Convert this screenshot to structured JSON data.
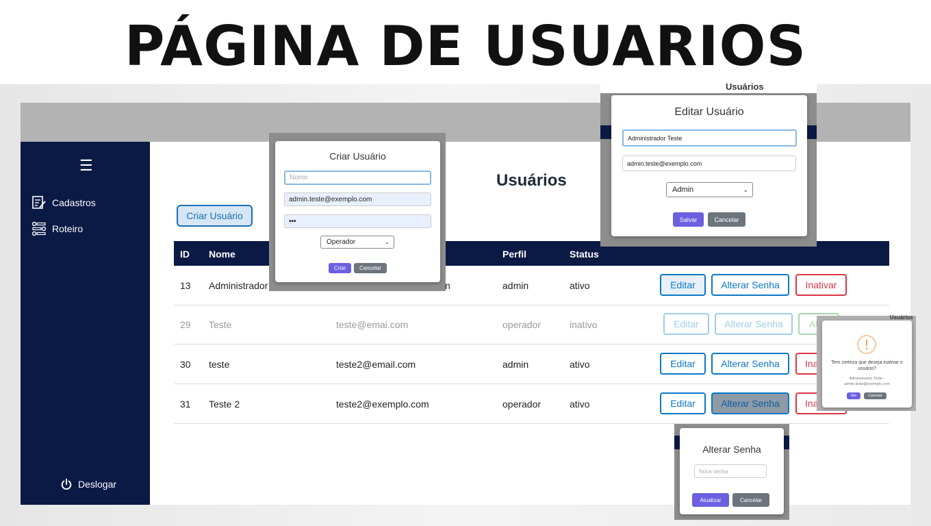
{
  "banner": {
    "title": "PÁGINA DE USUARIOS"
  },
  "sidebar": {
    "menu_icon": "hamburger-icon",
    "items": [
      {
        "label": "Cadastros",
        "icon": "form-edit-icon"
      },
      {
        "label": "Roteiro",
        "icon": "route-icon"
      }
    ],
    "logout": {
      "label": "Deslogar",
      "icon": "power-icon"
    }
  },
  "main": {
    "heading": "Usuários",
    "create_button": "Criar Usuário",
    "table": {
      "headers": [
        "ID",
        "Nome",
        "Perfil",
        "Status"
      ],
      "rows": [
        {
          "id": "13",
          "nome": "Administrador",
          "email": "n",
          "perfil": "admin",
          "status": "ativo",
          "actions": [
            "Editar",
            "Alterar Senha",
            "Inativar"
          ]
        },
        {
          "id": "29",
          "nome": "Teste",
          "email": "teste@emai.com",
          "perfil": "operador",
          "status": "inativo",
          "actions": [
            "Editar",
            "Alterar Senha",
            "At"
          ]
        },
        {
          "id": "30",
          "nome": "teste",
          "email": "teste2@email.com",
          "perfil": "admin",
          "status": "ativo",
          "actions": [
            "Editar",
            "Alterar Senha",
            "Ina"
          ]
        },
        {
          "id": "31",
          "nome": "Teste 2",
          "email": "teste2@exemplo.com",
          "perfil": "operador",
          "status": "ativo",
          "actions": [
            "Editar",
            "Alterar Senha",
            "Ina"
          ]
        }
      ]
    }
  },
  "create_modal": {
    "title": "Criar Usuário",
    "name_placeholder": "Nome",
    "email_value": "admin.teste@exemplo.com",
    "password_value": "•••",
    "profile_value": "Operador",
    "submit": "Criar",
    "cancel": "Cancelar"
  },
  "edit_modal": {
    "behind_heading": "Usuários",
    "title": "Editar Usuário",
    "name_value": "Administrador Teste",
    "email_value": "admin.teste@exemplo.com",
    "profile_value": "Admin",
    "save": "Salvar",
    "cancel": "Cancelar"
  },
  "confirm_modal": {
    "behind_heading": "Usuários",
    "icon": "warning-icon",
    "question": "Tem certeza que deseja inativar o usuário?",
    "detail": "Administrador Teste - admin.teste@exemplo.com",
    "yes": "Sim",
    "cancel": "Cancelar"
  },
  "password_modal": {
    "title": "Alterar Senha",
    "new_password_placeholder": "Nova senha",
    "submit": "Atualizar",
    "cancel": "Cancelar"
  },
  "colors": {
    "sidebar": "#0b1a45",
    "primary_blue": "#0a77c7",
    "danger": "#dc3545",
    "success": "#28a745",
    "modal_primary": "#6c5fe0",
    "modal_secondary": "#6c757d"
  }
}
